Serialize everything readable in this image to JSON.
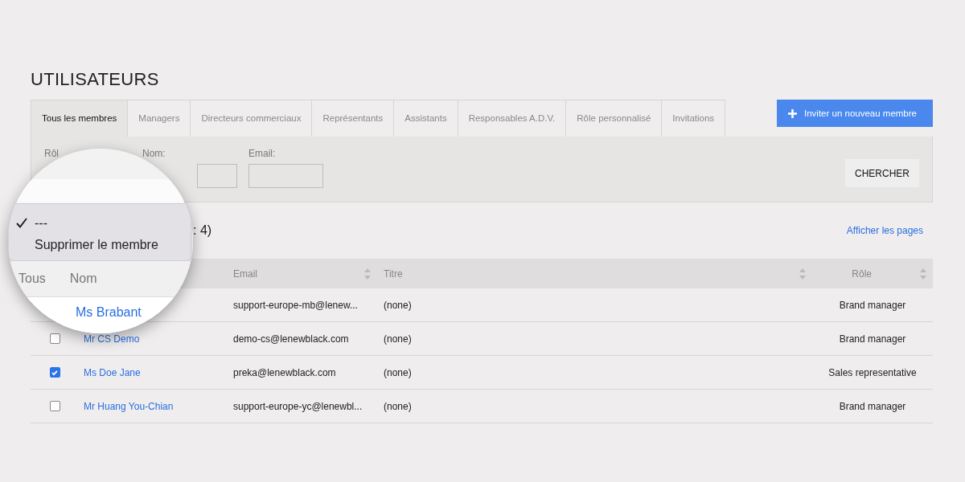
{
  "page_title": "UTILISATEURS",
  "tabs": [
    {
      "label": "Tous les membres",
      "selected": true
    },
    {
      "label": "Managers",
      "selected": false
    },
    {
      "label": "Directeurs commerciaux",
      "selected": false
    },
    {
      "label": "Représentants",
      "selected": false
    },
    {
      "label": "Assistants",
      "selected": false
    },
    {
      "label": "Responsables A.D.V.",
      "selected": false
    },
    {
      "label": "Rôle personnalisé",
      "selected": false
    },
    {
      "label": "Invitations",
      "selected": false
    }
  ],
  "invite_button": "Inviter un nouveau membre",
  "filters": {
    "role_label": "Rôl",
    "name_label": "Nom:",
    "email_label": "Email:",
    "search_button": "CHERCHER"
  },
  "count_text": ": 4)",
  "pages_link": "Afficher les pages",
  "table": {
    "columns": [
      "Email",
      "Titre",
      "Rôle"
    ],
    "rows": [
      {
        "email": "support-europe-mb@lenew...",
        "title": "(none)",
        "role": "Brand manager"
      },
      {
        "checked": false,
        "name": "Mr CS Demo",
        "email": "demo-cs@lenewblack.com",
        "title": "(none)",
        "role": "Brand manager"
      },
      {
        "checked": true,
        "name": "Ms Doe Jane",
        "email": "preka@lenewblack.com",
        "title": "(none)",
        "role": "Sales representative"
      },
      {
        "checked": false,
        "name": "Mr Huang You-Chian",
        "email": "support-europe-yc@lenewbl...",
        "title": "(none)",
        "role": "Brand manager"
      }
    ]
  },
  "magnifier": {
    "menu": [
      {
        "label": "---",
        "selected": true
      },
      {
        "label": "Supprimer le membre",
        "selected": false
      }
    ],
    "columns": [
      "Tous",
      "Nom"
    ],
    "row_name": "Ms Brabant"
  }
}
